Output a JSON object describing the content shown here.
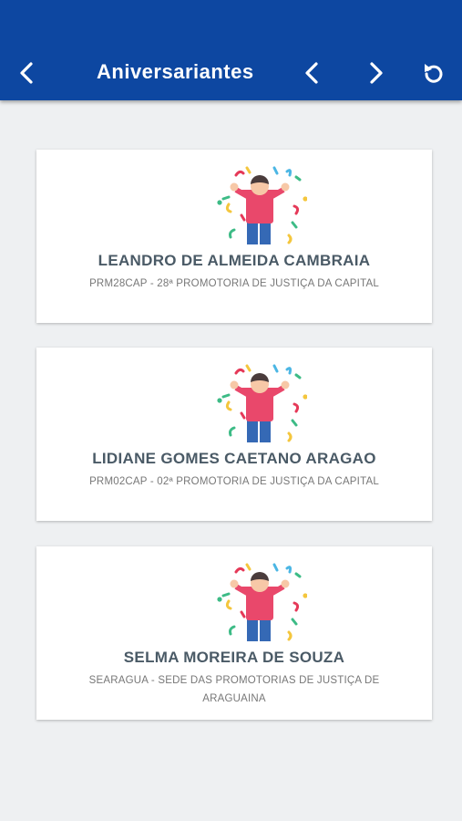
{
  "header": {
    "title": "Aniversariantes",
    "back_icon": "chevron-left-icon",
    "prev_icon": "chevron-left-icon",
    "next_icon": "chevron-right-icon",
    "refresh_icon": "refresh-icon",
    "background": "#0d47a1"
  },
  "people": [
    {
      "name": "LEANDRO DE ALMEIDA CAMBRAIA",
      "unit": "PRM28CAP - 28ª PROMOTORIA DE JUSTIÇA DA CAPITAL"
    },
    {
      "name": "LIDIANE GOMES CAETANO ARAGAO",
      "unit": "PRM02CAP - 02ª PROMOTORIA DE JUSTIÇA DA CAPITAL"
    },
    {
      "name": "SELMA MOREIRA DE SOUZA",
      "unit": "SEARAGUA - SEDE DAS PROMOTORIAS DE JUSTIÇA DE ARAGUAINA"
    }
  ],
  "illustration": "celebrating-person-icon"
}
